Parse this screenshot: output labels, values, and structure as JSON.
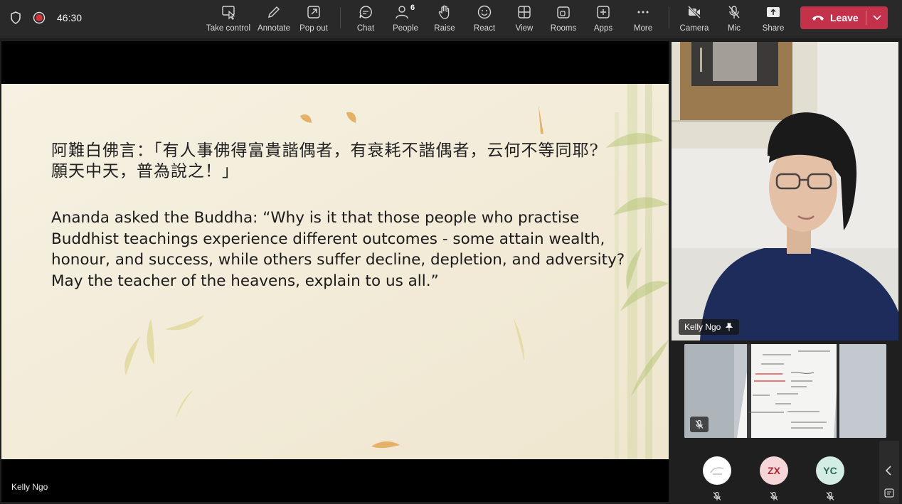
{
  "status": {
    "timer": "46:30"
  },
  "toolbar": {
    "take_control": "Take control",
    "annotate": "Annotate",
    "pop_out": "Pop out",
    "chat": "Chat",
    "people": "People",
    "people_count": "6",
    "raise": "Raise",
    "react": "React",
    "view": "View",
    "rooms": "Rooms",
    "apps": "Apps",
    "more": "More",
    "camera": "Camera",
    "mic": "Mic",
    "share": "Share",
    "leave": "Leave"
  },
  "slide": {
    "zh_text": "阿難白佛言：「有人事佛得富貴諧偶者，有衰耗不諧偶者，云何不等同耶? 願天中天，普為說之！」",
    "en_text": "Ananda asked the Buddha: “Why is it that those people who practise Buddhist teachings experience different outcomes - some attain wealth, honour, and success, while others suffer decline, depletion, and adversity? May the teacher of the heavens, explain to us all.”"
  },
  "stage": {
    "presenter_name": "Kelly Ngo"
  },
  "participants": {
    "featured_name": "Kelly Ngo",
    "avatars": [
      {
        "initials": "",
        "color": "#ffffff"
      },
      {
        "initials": "ZX",
        "color": "#f6d6d8",
        "text_color": "#b3262f"
      },
      {
        "initials": "YC",
        "color": "#d3ece4",
        "text_color": "#2f6a55"
      }
    ]
  },
  "colors": {
    "leave": "#c4314b",
    "toolbar_bg": "#292929",
    "slide_bg": "#f3eddc"
  }
}
